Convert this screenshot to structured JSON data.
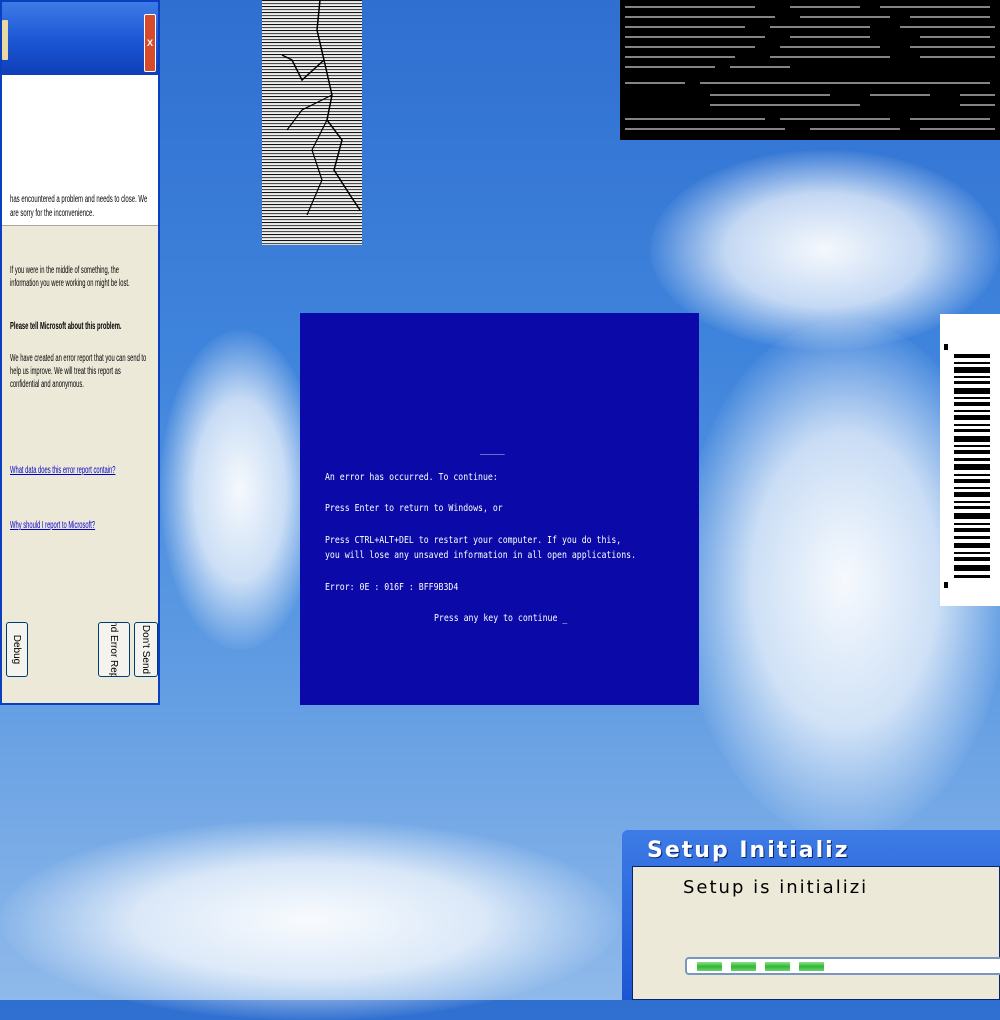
{
  "xp_dialog": {
    "close_label": "X",
    "header_text": "has encountered a problem and needs to close. We are sorry for the inconvenience.",
    "body_line1": "If you were in the middle of something, the information you were working on might be lost.",
    "body_bold": "Please tell Microsoft about this problem.",
    "body_line2": "We have created an error report that you can send to help us improve. We will treat this report as confidential and anonymous.",
    "link1": "What data does this error report contain?",
    "link2": "Why should I report to Microsoft?",
    "button_debug": "Debug",
    "button_send": "Send Error Report",
    "button_dont_send": "Don't Send"
  },
  "bsod": {
    "dash": "_____",
    "line1": "An error has occurred. To continue:",
    "line2": "Press Enter to return to Windows, or",
    "line3": "Press CTRL+ALT+DEL to restart your computer. If you do this,",
    "line4": "you will lose any unsaved information in all open applications.",
    "line5": "Error: 0E : 016F : BFF9B3D4",
    "line6": "Press any key to continue _",
    "background": "#0b0aa8"
  },
  "setup": {
    "title": "Setup Initializ",
    "message": "Setup is initializi",
    "progress_blocks": 4
  },
  "colors": {
    "sky": "#3f84dc",
    "xp_blue": "#1c55d3",
    "progress_green": "#2fb82f"
  }
}
